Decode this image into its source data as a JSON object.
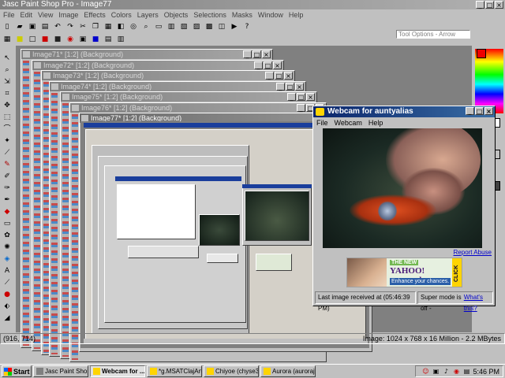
{
  "app": {
    "title": "Jasc Paint Shop Pro - Image77",
    "menu": [
      "File",
      "Edit",
      "View",
      "Image",
      "Effects",
      "Colors",
      "Layers",
      "Objects",
      "Selections",
      "Masks",
      "Window",
      "Help"
    ],
    "tool_options_label": "Tool Options - Arrow"
  },
  "image_windows": [
    {
      "title": "Image71* [1:2] (Background)"
    },
    {
      "title": "Image72* [1:2] (Background)"
    },
    {
      "title": "Image73* [1:2] (Background)"
    },
    {
      "title": "Image74* [1:2] (Background)"
    },
    {
      "title": "Image75* [1:2] (Background)"
    },
    {
      "title": "Image76* [1:2] (Background)"
    },
    {
      "title": "Image77* [1:2] (Background)"
    }
  ],
  "webcam": {
    "title": "Webcam for auntyalias",
    "menu": [
      "File",
      "Webcam",
      "Help"
    ],
    "report_link": "Report Abuse",
    "ad": {
      "line1": "THE NEW",
      "line2": "YAHOO! personals",
      "line3": "Enhance your chances.",
      "click": "CLICK"
    },
    "status_last_image": "Last image received at (05:46:39 PM)",
    "status_super": "Super mode is off -",
    "status_link": "What's this?"
  },
  "statusbar": {
    "coords": "(916, 714)",
    "image_info": "Image: 1024 x 768 x 16 Million - 2.2 MBytes"
  },
  "taskbar": {
    "start_label": "Start",
    "tasks": [
      {
        "label": "Jasc Paint Shop ...",
        "active": false
      },
      {
        "label": "Webcam for ...",
        "active": true
      },
      {
        "label": "*g.MSATClajArt...",
        "active": false
      },
      {
        "label": "Chiyoe (chyse3...",
        "active": false
      },
      {
        "label": "Aurora (aurorajv)...",
        "active": false
      }
    ],
    "clock": "5:46 PM"
  },
  "colors": {
    "titlebar_active": "#0a246a",
    "titlebar_inactive": "#808080",
    "desktop_gray": "#c0c0c0",
    "link": "#0000cc"
  }
}
